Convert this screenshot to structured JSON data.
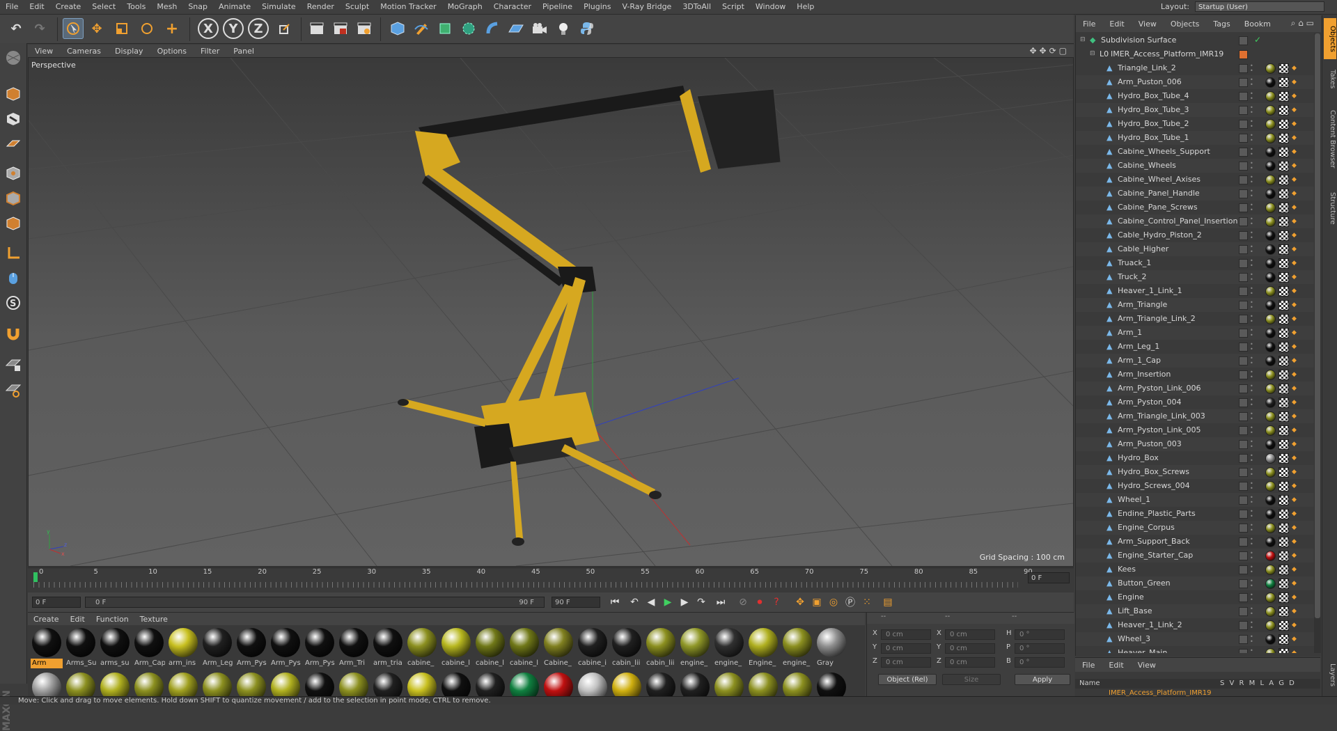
{
  "menu": [
    "File",
    "Edit",
    "Create",
    "Select",
    "Tools",
    "Mesh",
    "Snap",
    "Animate",
    "Simulate",
    "Render",
    "Sculpt",
    "Motion Tracker",
    "MoGraph",
    "Character",
    "Pipeline",
    "Plugins",
    "V-Ray Bridge",
    "3DToAll",
    "Script",
    "Window",
    "Help"
  ],
  "layout": {
    "label": "Layout:",
    "value": "Startup (User)"
  },
  "toolbar": {
    "undo": "↶",
    "redo": "↷",
    "x_axis": "X",
    "y_axis": "Y",
    "z_axis": "Z"
  },
  "viewport": {
    "menu": [
      "View",
      "Cameras",
      "Display",
      "Options",
      "Filter",
      "Panel"
    ],
    "label": "Perspective",
    "grid_spacing": "Grid Spacing : 100 cm",
    "axis_x": "x",
    "axis_y": "y",
    "axis_z": "z"
  },
  "timeline": {
    "ticks": [
      "0",
      "5",
      "10",
      "15",
      "20",
      "25",
      "30",
      "35",
      "40",
      "45",
      "50",
      "55",
      "60",
      "65",
      "70",
      "75",
      "80",
      "85",
      "90"
    ],
    "current_frame": "0 F"
  },
  "transport": {
    "start": "0 F",
    "range_start": "0 F",
    "range_end": "90 F",
    "end": "90 F"
  },
  "materials": {
    "menu": [
      "Create",
      "Edit",
      "Function",
      "Texture"
    ],
    "row1": [
      {
        "name": "Arm",
        "color": "#101010"
      },
      {
        "name": "Arms_Su",
        "color": "#101010"
      },
      {
        "name": "arms_su",
        "color": "#101010"
      },
      {
        "name": "Arm_Cap",
        "color": "#101010"
      },
      {
        "name": "arm_ins",
        "color": "#c8c020"
      },
      {
        "name": "Arm_Leg",
        "color": "#202020"
      },
      {
        "name": "Arm_Pys",
        "color": "#101010"
      },
      {
        "name": "Arm_Pys",
        "color": "#101010"
      },
      {
        "name": "Arm_Pys",
        "color": "#101010"
      },
      {
        "name": "Arm_Tri",
        "color": "#101010"
      },
      {
        "name": "arm_tria",
        "color": "#101010"
      },
      {
        "name": "cabine_",
        "color": "#8c9020"
      },
      {
        "name": "cabine_l",
        "color": "#b8b820"
      },
      {
        "name": "cabine_l",
        "color": "#707818"
      },
      {
        "name": "cabine_l",
        "color": "#707818"
      },
      {
        "name": "Cabine_",
        "color": "#808020"
      },
      {
        "name": "cabine_i",
        "color": "#202020"
      },
      {
        "name": "cabin_lii",
        "color": "#202020"
      },
      {
        "name": "cabin_lii",
        "color": "#8c9020"
      },
      {
        "name": "engine_",
        "color": "#909828"
      },
      {
        "name": "engine_",
        "color": "#303030"
      },
      {
        "name": "Engine_",
        "color": "#b0b020"
      },
      {
        "name": "engine_",
        "color": "#8c9020"
      },
      {
        "name": "Gray",
        "color": "#909090"
      }
    ],
    "row2_colors": [
      "#a0a0a0",
      "#8c9020",
      "#b0b020",
      "#8c9020",
      "#a0a020",
      "#8c9020",
      "#8c9020",
      "#b0b020",
      "#101010",
      "#8c9020",
      "#202020",
      "#c8c020",
      "#101010",
      "#202020",
      "#108040",
      "#c01010",
      "#c0c0c0",
      "#d0b010",
      "#202020",
      "#202020",
      "#8c9020",
      "#8c9020",
      "#8c9020",
      "#101010"
    ]
  },
  "coords": {
    "header1": "--",
    "header2": "--",
    "header3": "--",
    "x": "X",
    "y": "Y",
    "z": "Z",
    "x_val": "0 cm",
    "y_val": "0 cm",
    "z_val": "0 cm",
    "sx": "X",
    "sy": "Y",
    "sz": "Z",
    "sx_val": "0 cm",
    "sy_val": "0 cm",
    "sz_val": "0 cm",
    "h": "H",
    "p": "P",
    "b": "B",
    "h_val": "0 °",
    "p_val": "0 °",
    "b_val": "0 °",
    "mode": "Object (Rel)",
    "size": "Size",
    "apply": "Apply"
  },
  "status": "Move: Click and drag to move elements. Hold down SHIFT to quantize movement / add to the selection in point mode, CTRL to remove.",
  "objects": {
    "menu": [
      "File",
      "Edit",
      "View",
      "Objects",
      "Tags",
      "Bookm"
    ],
    "root": "Subdivision Surface",
    "group": "IMER_Access_Platform_IMR19",
    "items": [
      {
        "name": "Triangle_Link_2",
        "tag": "#8c9020"
      },
      {
        "name": "Arm_Puston_006",
        "tag": "#101010"
      },
      {
        "name": "Hydro_Box_Tube_4",
        "tag": "#8c9020"
      },
      {
        "name": "Hydro_Box_Tube_3",
        "tag": "#8c9020"
      },
      {
        "name": "Hydro_Box_Tube_2",
        "tag": "#8c9020"
      },
      {
        "name": "Hydro_Box_Tube_1",
        "tag": "#8c9020"
      },
      {
        "name": "Cabine_Wheels_Support",
        "tag": "#101010"
      },
      {
        "name": "Cabine_Wheels",
        "tag": "#101010"
      },
      {
        "name": "Cabine_Wheel_Axises",
        "tag": "#8c9020"
      },
      {
        "name": "Cabine_Panel_Handle",
        "tag": "#101010"
      },
      {
        "name": "Cabine_Pane_Screws",
        "tag": "#8c9020"
      },
      {
        "name": "Cabine_Control_Panel_Insertion",
        "tag": "#8c9020"
      },
      {
        "name": "Cable_Hydro_Piston_2",
        "tag": "#101010"
      },
      {
        "name": "Cable_Higher",
        "tag": "#101010"
      },
      {
        "name": "Truack_1",
        "tag": "#101010"
      },
      {
        "name": "Truck_2",
        "tag": "#101010"
      },
      {
        "name": "Heaver_1_Link_1",
        "tag": "#8c9020"
      },
      {
        "name": "Arm_Triangle",
        "tag": "#101010"
      },
      {
        "name": "Arm_Triangle_Link_2",
        "tag": "#8c9020"
      },
      {
        "name": "Arm_1",
        "tag": "#101010"
      },
      {
        "name": "Arm_Leg_1",
        "tag": "#101010"
      },
      {
        "name": "Arm_1_Cap",
        "tag": "#101010"
      },
      {
        "name": "Arm_Insertion",
        "tag": "#8c9020"
      },
      {
        "name": "Arm_Pyston_Link_006",
        "tag": "#8c9020"
      },
      {
        "name": "Arm_Pyston_004",
        "tag": "#202020"
      },
      {
        "name": "Arm_Triangle_Link_003",
        "tag": "#8c9020"
      },
      {
        "name": "Arm_Pyston_Link_005",
        "tag": "#8c9020"
      },
      {
        "name": "Arm_Puston_003",
        "tag": "#101010"
      },
      {
        "name": "Hydro_Box",
        "tag": "#909090"
      },
      {
        "name": "Hydro_Box_Screws",
        "tag": "#8c9020"
      },
      {
        "name": "Hydro_Screws_004",
        "tag": "#8c9020"
      },
      {
        "name": "Wheel_1",
        "tag": "#101010"
      },
      {
        "name": "Endine_Plastic_Parts",
        "tag": "#101010"
      },
      {
        "name": "Engine_Corpus",
        "tag": "#8c9020"
      },
      {
        "name": "Arm_Support_Back",
        "tag": "#101010"
      },
      {
        "name": "Engine_Starter_Cap",
        "tag": "#c01010"
      },
      {
        "name": "Kees",
        "tag": "#8c9020"
      },
      {
        "name": "Button_Green",
        "tag": "#108040"
      },
      {
        "name": "Engine",
        "tag": "#8c9020"
      },
      {
        "name": "Lift_Base",
        "tag": "#8c9020"
      },
      {
        "name": "Heaver_1_Link_2",
        "tag": "#8c9020"
      },
      {
        "name": "Wheel_3",
        "tag": "#101010"
      },
      {
        "name": "Heaver_Main",
        "tag": "#8c9020"
      }
    ]
  },
  "side_tabs": [
    "Objects",
    "Takes",
    "Content Browser",
    "Structure"
  ],
  "layers": {
    "menu": [
      "File",
      "Edit",
      "View"
    ],
    "col_name": "Name",
    "cols": "S V R M L A G D",
    "row": "IMER_Access_Platform_IMR19"
  },
  "bottom_side_tab": "Layers"
}
